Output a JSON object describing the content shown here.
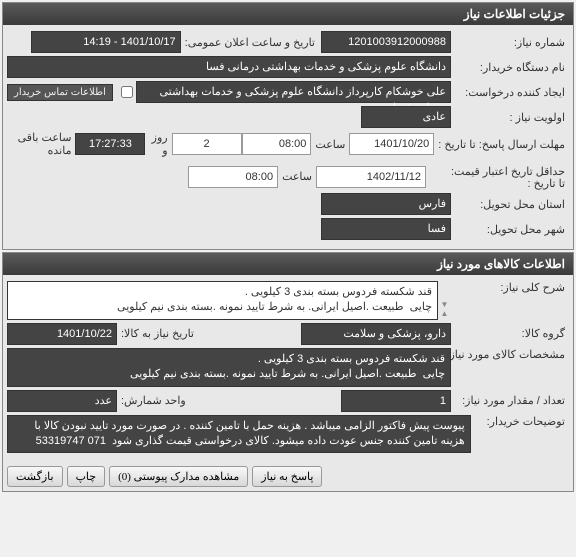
{
  "header1": "جزئیات اطلاعات نیاز",
  "header2": "اطلاعات کالاهای مورد نیاز",
  "labels": {
    "requestNo": "شماره نیاز:",
    "announceDateTime": "تاریخ و ساعت اعلان عمومی:",
    "buyerOrg": "نام دستگاه خریدار:",
    "requestCreator": "ایجاد کننده درخواست:",
    "contactInfo": "اطلاعات تماس خریدار",
    "priority": "اولویت نیاز :",
    "responseDeadlineFrom": "مهلت ارسال پاسخ:  تا تاریخ :",
    "validityTo": "حداقل تاریخ اعتبار قیمت:",
    "toDate": "تا تاریخ :",
    "time": "ساعت",
    "and": "و",
    "day": "روز و",
    "hoursRemain": "ساعت باقی مانده",
    "deliveryProvince": "استان محل تحویل:",
    "deliveryCity": "شهر محل تحویل:",
    "generalDesc": "شرح کلی نیاز:",
    "goodsGroup": "گروه کالا:",
    "needDateForGoods": "تاریخ نیاز به کالا:",
    "goodsSpec": "مشخصات کالای مورد نیاز:",
    "qty": "تعداد / مقدار مورد نیاز:",
    "unit": "واحد شمارش:",
    "count": "عدد",
    "buyerNotes": "توضیحات خریدار:"
  },
  "fields": {
    "requestNo": "1201003912000988",
    "announceDateTime": "1401/10/17 - 14:19",
    "buyerOrg": "دانشگاه علوم پزشکی و خدمات بهداشتی درمانی فسا",
    "requestCreator": "علی خوشکام کارپرداز دانشگاه علوم پزشکی و خدمات بهداشتی درمانی فسا",
    "priority": "عادی",
    "date1": "1401/10/20",
    "time1": "08:00",
    "days": "2",
    "countdown": "17:27:33",
    "date2": "1402/11/12",
    "time2": "08:00",
    "province": "فارس",
    "city": "فسا",
    "generalDesc": "قند شکسته فردوس بسته بندی 3 کیلویی .\nچایی  طبیعت .اصیل ایرانی. به شرط تایید نمونه .بسته بندی نیم کیلویی",
    "goodsGroup": "دارو، پزشکی و سلامت",
    "needDate": "1401/10/22",
    "goodsSpec": "قند شکسته فردوس بسته بندی 3 کیلویی .\nچایی  طبیعت .اصیل ایرانی. به شرط تایید نمونه .بسته بندی نیم کیلویی",
    "qty": "1",
    "buyerNotes": "پیوست پیش فاکتور الزامی میباشد . هزینه حمل با تامین کننده . در صورت مورد تایید نبودن کالا با هزینه تامین کننده جنس عودت داده میشود. کالای درخواستی قیمت گذاری شود  071 53319747"
  },
  "buttons": {
    "reply": "پاسخ به نیاز",
    "viewAttach": "مشاهده مدارک پیوستی (0)",
    "print": "چاپ",
    "back": "بازگشت"
  }
}
